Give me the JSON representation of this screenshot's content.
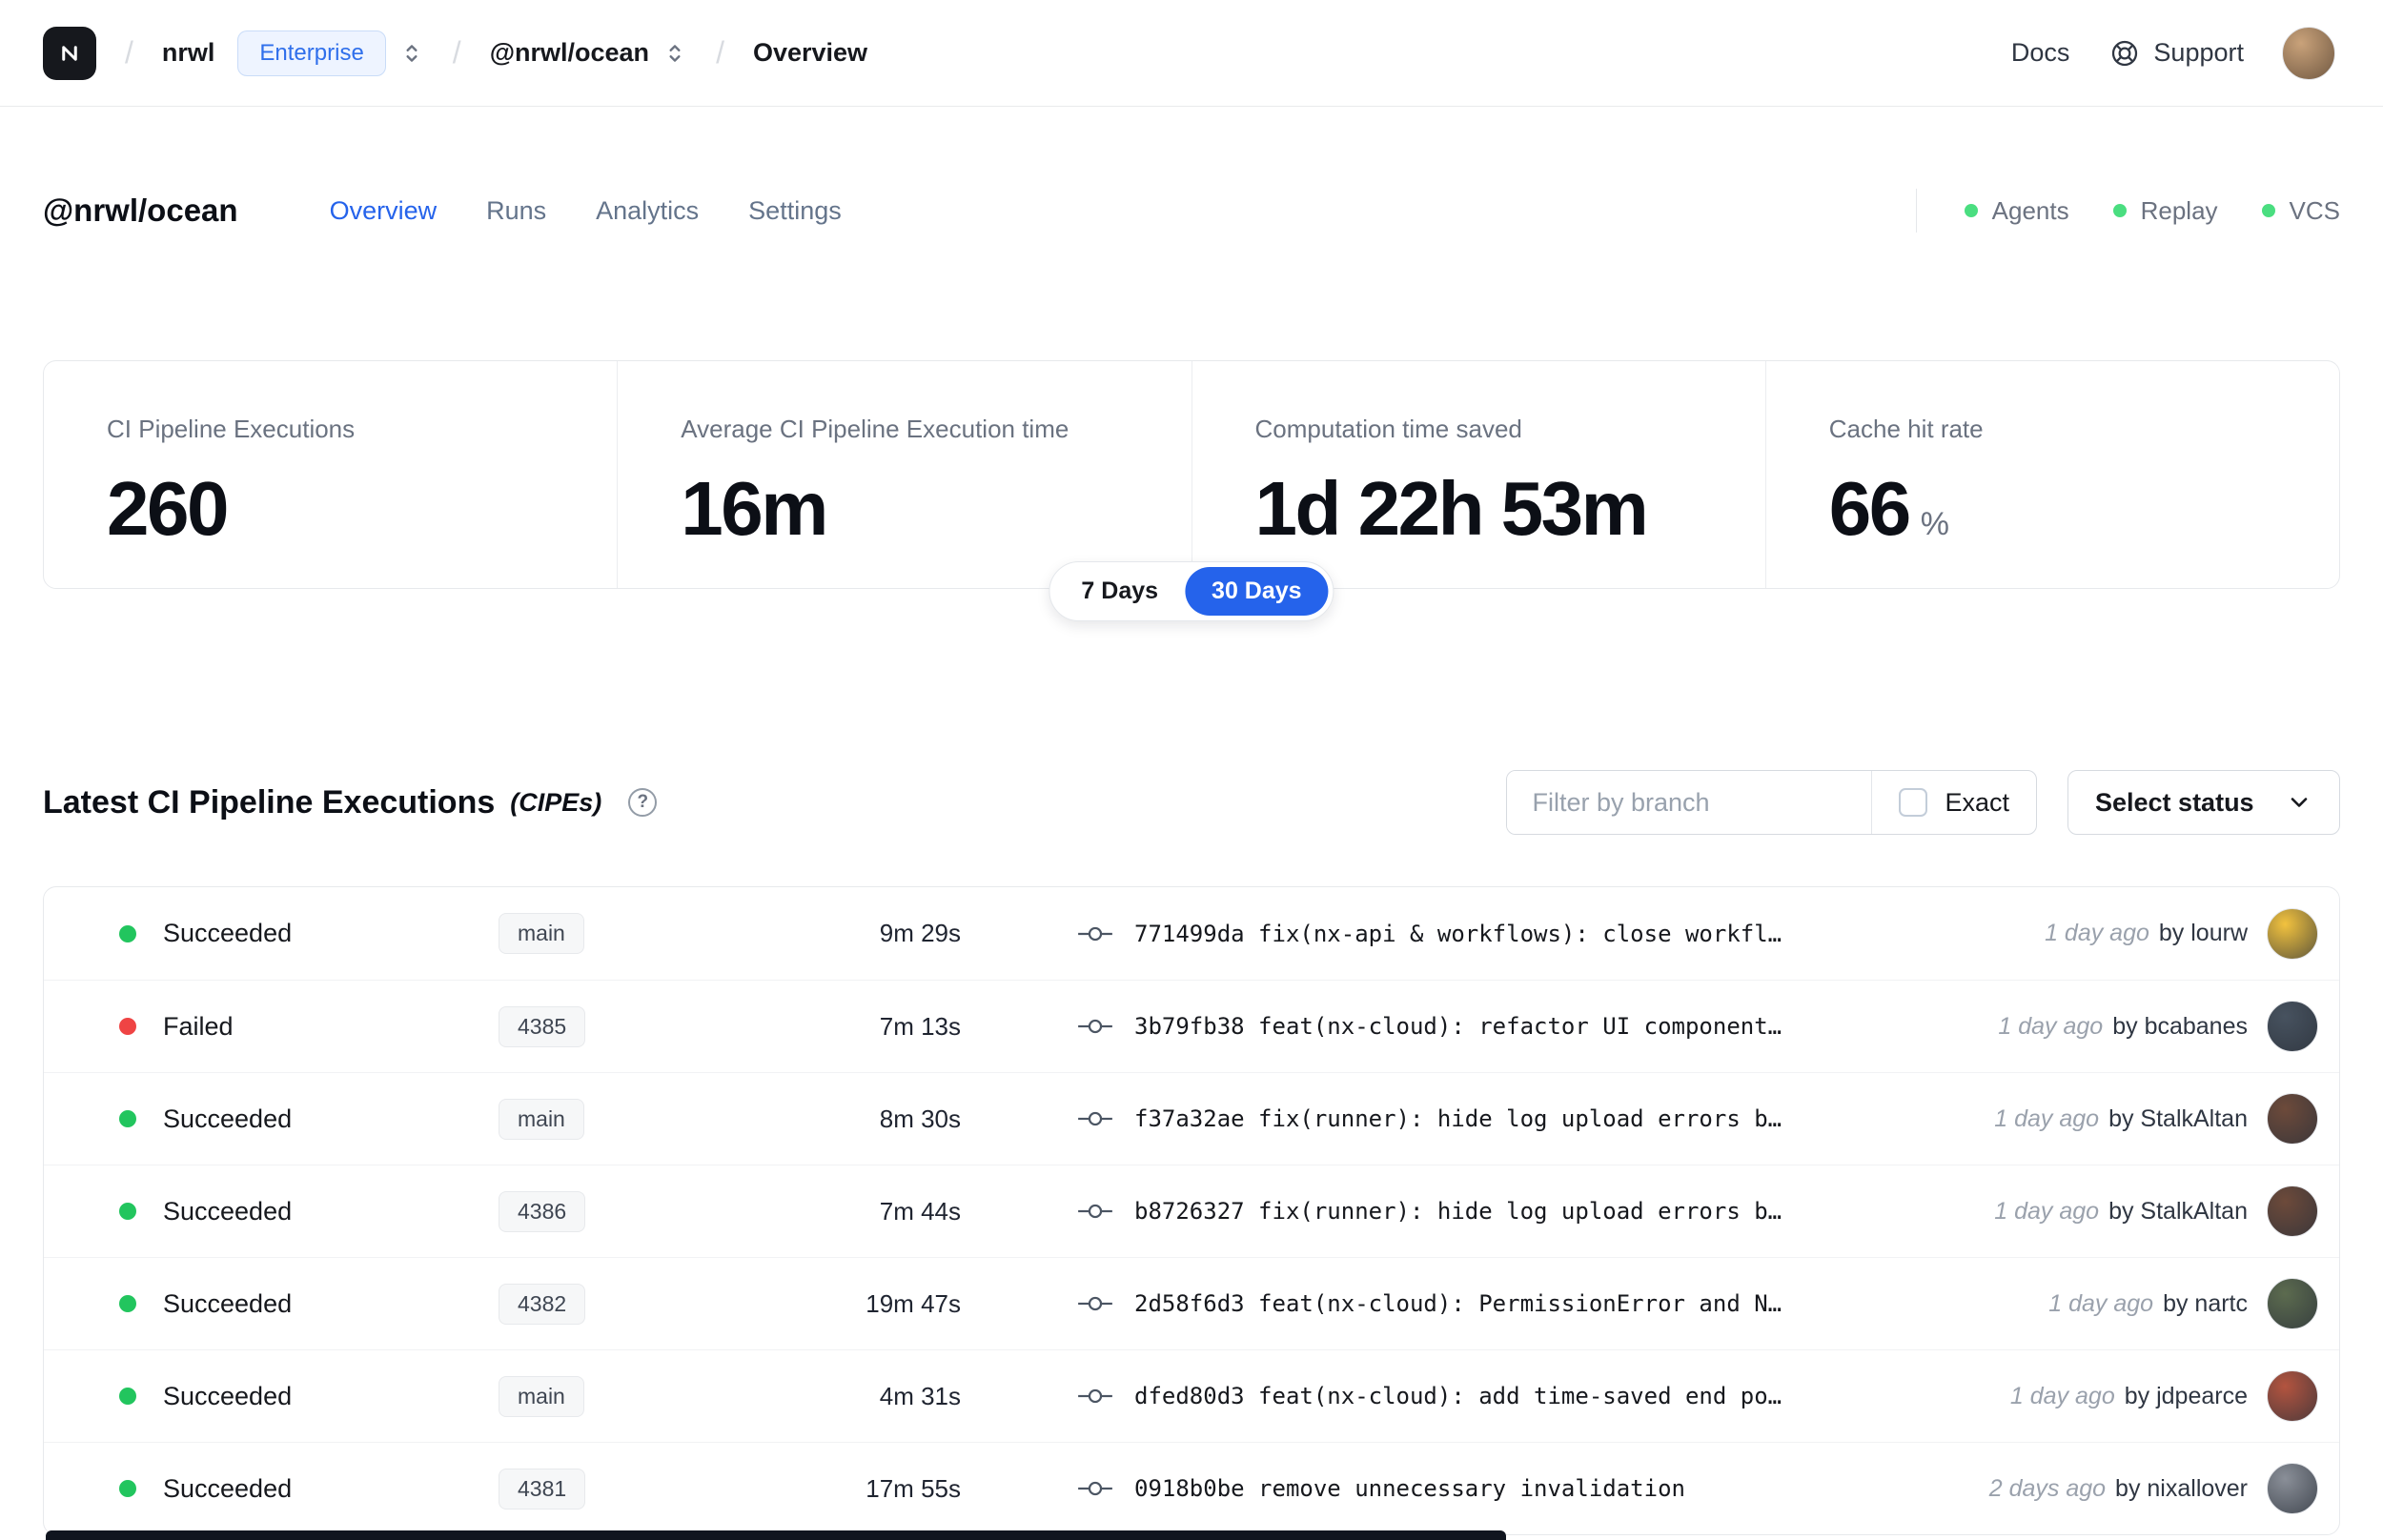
{
  "navbar": {
    "separator": "/",
    "org": "nrwl",
    "plan_badge": "Enterprise",
    "workspace": "@nrwl/ocean",
    "page": "Overview",
    "docs_label": "Docs",
    "support_label": "Support"
  },
  "workspace_header": {
    "title": "@nrwl/ocean",
    "tabs": [
      {
        "label": "Overview",
        "active": true
      },
      {
        "label": "Runs",
        "active": false
      },
      {
        "label": "Analytics",
        "active": false
      },
      {
        "label": "Settings",
        "active": false
      }
    ],
    "indicators": [
      {
        "label": "Agents"
      },
      {
        "label": "Replay"
      },
      {
        "label": "VCS"
      }
    ]
  },
  "stats": {
    "cards": [
      {
        "label": "CI Pipeline Executions",
        "value": "260"
      },
      {
        "label": "Average CI Pipeline Execution time",
        "value": "16m"
      },
      {
        "label": "Computation time saved",
        "value": "1d 22h 53m"
      },
      {
        "label": "Cache hit rate",
        "value": "66",
        "suffix": "%"
      }
    ],
    "range_toggle": [
      {
        "label": "7 Days",
        "active": false
      },
      {
        "label": "30 Days",
        "active": true
      }
    ]
  },
  "cipe": {
    "title": "Latest CI Pipeline Executions",
    "title_suffix": "(CIPEs)",
    "help_glyph": "?",
    "filter_placeholder": "Filter by branch",
    "exact_label": "Exact",
    "select_status_label": "Select status",
    "rows": [
      {
        "status": "Succeeded",
        "status_color": "green",
        "branch": "main",
        "duration": "9m 29s",
        "commit": "771499da fix(nx-api & workflows): close workfl…",
        "time": "1 day ago",
        "author": "by lourw",
        "avatar_color": "#f2c23e"
      },
      {
        "status": "Failed",
        "status_color": "red",
        "branch": "4385",
        "duration": "7m 13s",
        "commit": "3b79fb38 feat(nx-cloud): refactor UI component…",
        "time": "1 day ago",
        "author": "by bcabanes",
        "avatar_color": "#47525f"
      },
      {
        "status": "Succeeded",
        "status_color": "green",
        "branch": "main",
        "duration": "8m 30s",
        "commit": "f37a32ae fix(runner): hide log upload errors b…",
        "time": "1 day ago",
        "author": "by StalkAltan",
        "avatar_color": "#6d4a3a"
      },
      {
        "status": "Succeeded",
        "status_color": "green",
        "branch": "4386",
        "duration": "7m 44s",
        "commit": "b8726327 fix(runner): hide log upload errors b…",
        "time": "1 day ago",
        "author": "by StalkAltan",
        "avatar_color": "#6d4a3a"
      },
      {
        "status": "Succeeded",
        "status_color": "green",
        "branch": "4382",
        "duration": "19m 47s",
        "commit": "2d58f6d3 feat(nx-cloud): PermissionError and N…",
        "time": "1 day ago",
        "author": "by nartc",
        "avatar_color": "#5c6b4f"
      },
      {
        "status": "Succeeded",
        "status_color": "green",
        "branch": "main",
        "duration": "4m 31s",
        "commit": "dfed80d3 feat(nx-cloud): add time-saved end po…",
        "time": "1 day ago",
        "author": "by jdpearce",
        "avatar_color": "#b3543f"
      },
      {
        "status": "Succeeded",
        "status_color": "green",
        "branch": "4381",
        "duration": "17m 55s",
        "commit": "0918b0be remove unnecessary invalidation",
        "time": "2 days ago",
        "author": "by nixallover",
        "avatar_color": "#8a8f98"
      }
    ]
  },
  "colors": {
    "accent_blue": "#2563eb",
    "success_green": "#22c55e",
    "failed_red": "#ef4444",
    "indicator_green": "#4ade80"
  }
}
